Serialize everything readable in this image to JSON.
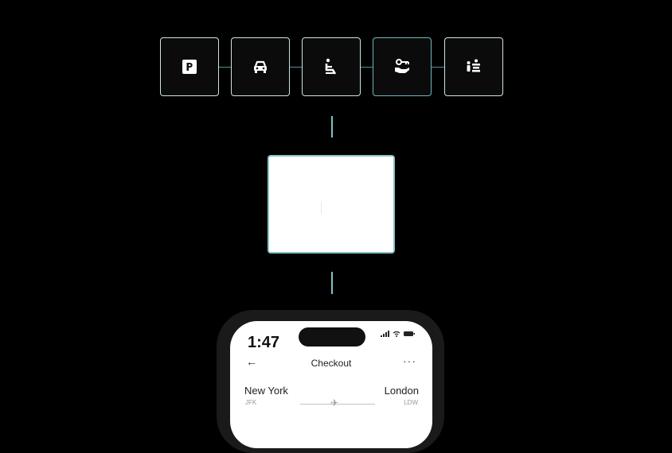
{
  "amenities": [
    {
      "name": "parking",
      "icon": "parking-icon"
    },
    {
      "name": "car",
      "icon": "car-icon"
    },
    {
      "name": "seat",
      "icon": "seat-icon"
    },
    {
      "name": "lounge-access",
      "icon": "key-hand-icon",
      "active": true
    },
    {
      "name": "family",
      "icon": "family-icon"
    }
  ],
  "phone": {
    "time": "1:47",
    "header": {
      "back": "←",
      "title": "Checkout",
      "more": "···"
    },
    "flight": {
      "from": {
        "city": "New York",
        "code": "JFK"
      },
      "to": {
        "city": "London",
        "code": "LDW"
      },
      "plane": "✈"
    }
  },
  "colors": {
    "accent": "#6fb7be",
    "background": "#000000",
    "card": "#ffffff"
  }
}
